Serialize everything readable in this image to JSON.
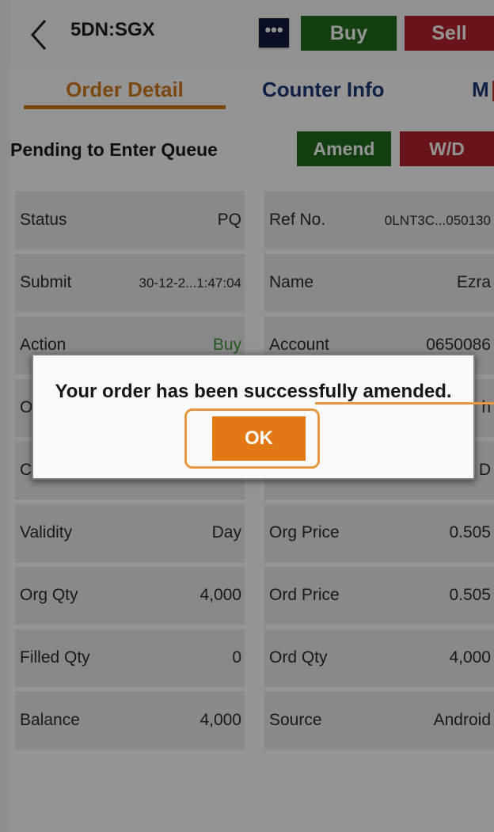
{
  "header": {
    "symbol": "5DN:SGX",
    "more_label": "•••",
    "buy_label": "Buy",
    "sell_label": "Sell"
  },
  "tabs": [
    "Order Detail",
    "Counter Info",
    "M"
  ],
  "status_line": {
    "text": "Pending to Enter Queue",
    "amend_label": "Amend",
    "withdraw_label": "W/D"
  },
  "details_left": [
    {
      "label": "Status",
      "value": "PQ"
    },
    {
      "label": "Submit",
      "value": "30-12-2...1:47:04"
    },
    {
      "label": "Action",
      "value": "Buy"
    },
    {
      "label": "Or",
      "value": ""
    },
    {
      "label": "Co",
      "value": ""
    },
    {
      "label": "Validity",
      "value": "Day"
    },
    {
      "label": "Org Qty",
      "value": "4,000"
    },
    {
      "label": "Filled Qty",
      "value": "0"
    },
    {
      "label": "Balance",
      "value": "4,000"
    }
  ],
  "details_right": [
    {
      "label": "Ref No.",
      "value": "0LNT3C...050130"
    },
    {
      "label": "Name",
      "value": "Ezra"
    },
    {
      "label": "Account",
      "value": "0650086"
    },
    {
      "label": "",
      "value": "h"
    },
    {
      "label": "",
      "value": "D"
    },
    {
      "label": "Org Price",
      "value": "0.505"
    },
    {
      "label": "Ord Price",
      "value": "0.505"
    },
    {
      "label": "Ord Qty",
      "value": "4,000"
    },
    {
      "label": "Source",
      "value": "Android"
    }
  ],
  "dialog": {
    "message": "Your order has been successfully amended.",
    "ok_label": "OK"
  },
  "colors": {
    "accent_orange": "#d67d20",
    "buy_green": "#226d1d",
    "sell_red": "#b3242b",
    "link_blue": "#1c3a7a",
    "ok_orange": "#e37914",
    "highlight": "#e7983e"
  }
}
